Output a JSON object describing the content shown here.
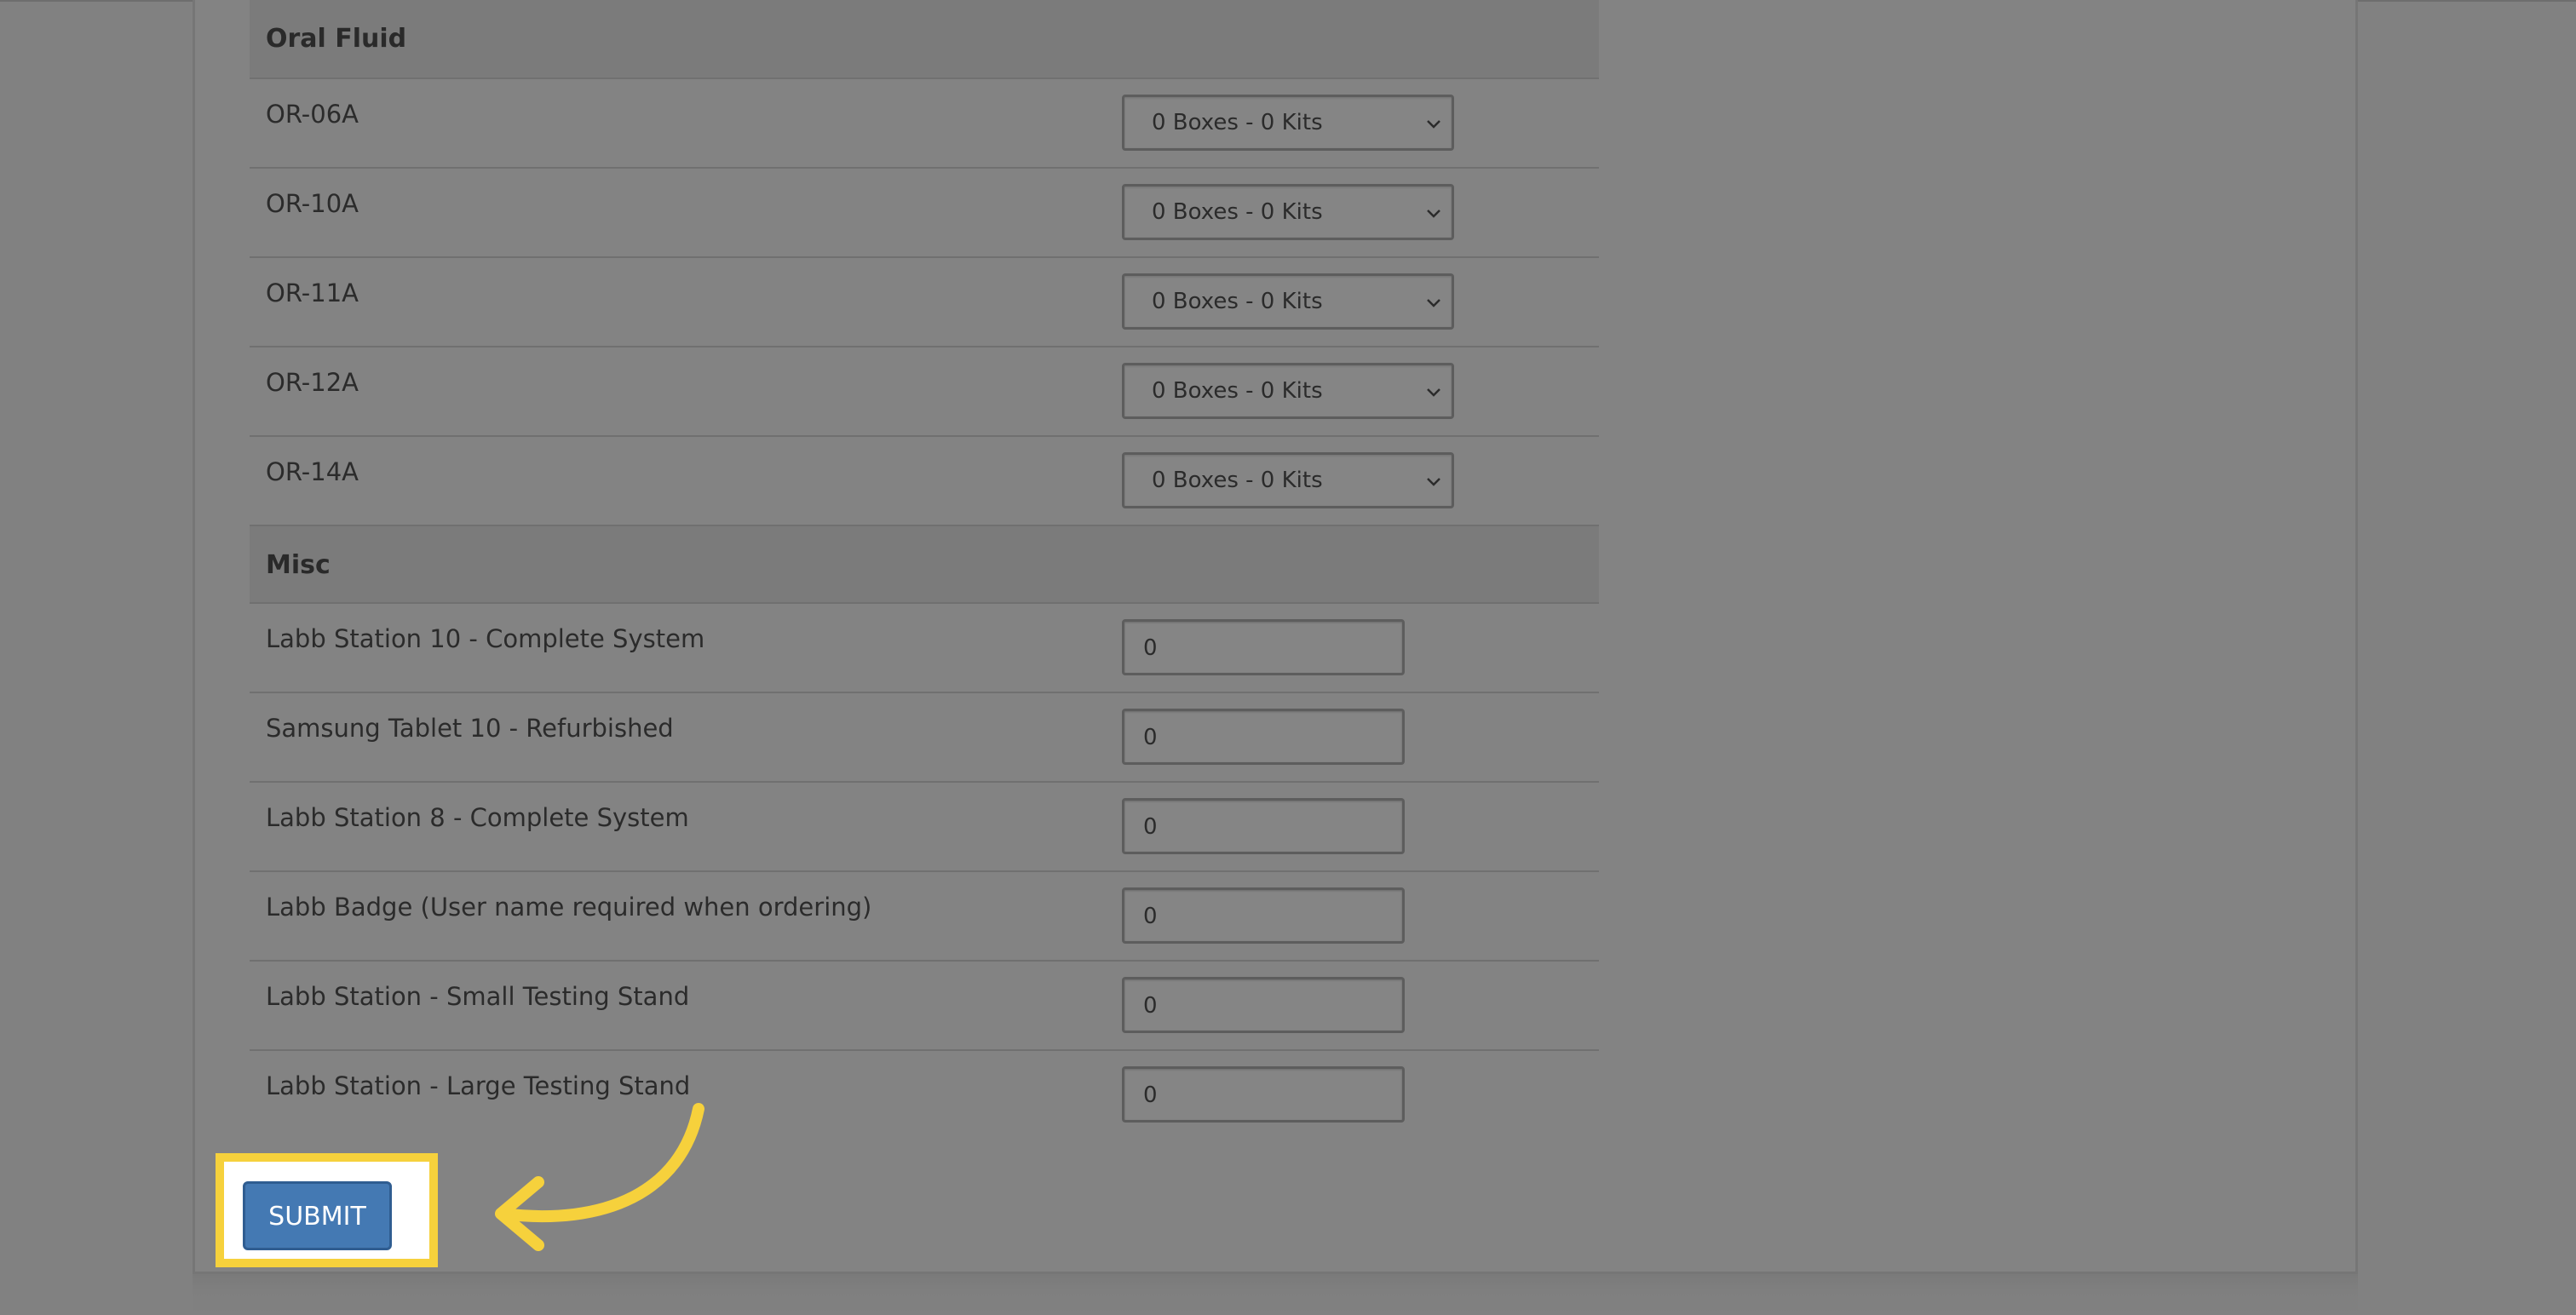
{
  "sections": [
    {
      "title": "Oral Fluid",
      "rows": [
        {
          "label": "OR-06A",
          "value": "0 Boxes - 0 Kits"
        },
        {
          "label": "OR-10A",
          "value": "0 Boxes - 0 Kits"
        },
        {
          "label": "OR-11A",
          "value": "0 Boxes - 0 Kits"
        },
        {
          "label": "OR-12A",
          "value": "0 Boxes - 0 Kits"
        },
        {
          "label": "OR-14A",
          "value": "0 Boxes - 0 Kits"
        }
      ]
    },
    {
      "title": "Misc",
      "rows": [
        {
          "label": "Labb Station 10 - Complete System",
          "value": "0"
        },
        {
          "label": "Samsung Tablet 10 - Refurbished",
          "value": "0"
        },
        {
          "label": "Labb Station 8 - Complete System",
          "value": "0"
        },
        {
          "label": "Labb Badge (User name required when ordering)",
          "value": "0"
        },
        {
          "label": "Labb Station - Small Testing Stand",
          "value": "0"
        },
        {
          "label": "Labb Station - Large Testing Stand",
          "value": "0"
        }
      ]
    }
  ],
  "submit": {
    "label": "SUBMIT"
  },
  "icons": {
    "dropdown": "chevron-down-icon",
    "annotation": "curved-arrow-icon"
  },
  "colors": {
    "highlight": "#f6d13c",
    "button": "#4479b3",
    "arrow": "#f6d13c"
  }
}
